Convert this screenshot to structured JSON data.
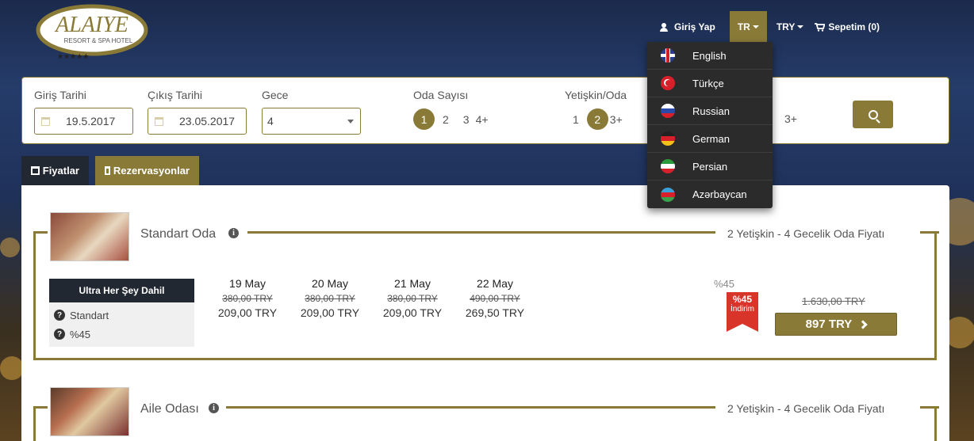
{
  "brand": {
    "logo_text": "ALAIYE",
    "logo_sub": "RESORT & SPA HOTEL"
  },
  "nav": {
    "login": "Giriş Yap",
    "language": "TR",
    "currency": "TRY",
    "cart": "Sepetim (0)"
  },
  "languages": [
    {
      "label": "English",
      "flag": "flag-uk-icon"
    },
    {
      "label": "Türkçe",
      "flag": "flag-tr-icon"
    },
    {
      "label": "Russian",
      "flag": "flag-ru-icon"
    },
    {
      "label": "German",
      "flag": "flag-de-icon"
    },
    {
      "label": "Persian",
      "flag": "flag-ir-icon"
    },
    {
      "label": "Azərbaycan",
      "flag": "flag-az-icon"
    }
  ],
  "search": {
    "checkin_label": "Giriş Tarihi",
    "checkin_value": "19.5.2017",
    "checkout_label": "Çıkış Tarihi",
    "checkout_value": "23.05.2017",
    "nights_label": "Gece",
    "nights_value": "4",
    "rooms_label": "Oda Sayısı",
    "rooms_options": [
      "1",
      "2",
      "3",
      "4+"
    ],
    "rooms_selected": "1",
    "adults_label": "Yetişkin/Oda",
    "adults_options": [
      "1",
      "2",
      "3+"
    ],
    "adults_selected": "2",
    "children_more": "3+"
  },
  "tabs": {
    "prices": "Fiyatlar",
    "reservations": "Rezervasyonlar"
  },
  "rooms": [
    {
      "name": "Standart Oda",
      "capacity": "2 Yetişkin - 4 Gecelik Oda Fiyatı",
      "board": "Ultra Her Şey Dahil",
      "features": [
        "Standart",
        "%45"
      ],
      "days": [
        {
          "date": "19 May",
          "old": "380,00 TRY",
          "new": "209,00 TRY"
        },
        {
          "date": "20 May",
          "old": "380,00 TRY",
          "new": "209,00 TRY"
        },
        {
          "date": "21 May",
          "old": "380,00 TRY",
          "new": "209,00 TRY"
        },
        {
          "date": "22 May",
          "old": "490,00 TRY",
          "new": "269,50 TRY"
        }
      ],
      "discount_text": "%45",
      "ribbon_pct": "%45",
      "ribbon_label": "İndirim",
      "total_old": "1.630,00 TRY",
      "total_new": "897 TRY"
    },
    {
      "name": "Aile Odası",
      "capacity": "2 Yetişkin - 4 Gecelik Oda Fiyatı"
    }
  ],
  "colors": {
    "accent": "#8a7a38",
    "dark": "#222831",
    "discount": "#d9342a"
  }
}
